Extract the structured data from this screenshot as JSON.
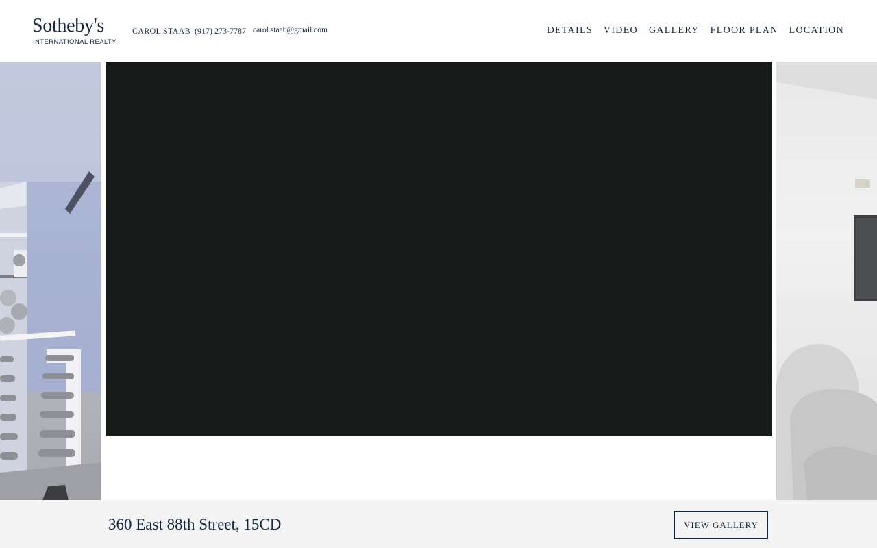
{
  "header": {
    "logo": {
      "word": "Sotheby's",
      "subtitle": "INTERNATIONAL REALTY"
    },
    "contact": {
      "name": "CAROL STAAB",
      "phone": "(917) 273-7787",
      "email": "carol.staab@gmail.com"
    },
    "nav": [
      {
        "label": "DETAILS"
      },
      {
        "label": "VIDEO"
      },
      {
        "label": "GALLERY"
      },
      {
        "label": "FLOOR PLAN"
      },
      {
        "label": "LOCATION"
      }
    ]
  },
  "listing": {
    "address": "360 East 88th Street, 15CD",
    "view_gallery_label": "VIEW GALLERY"
  },
  "colors": {
    "brand_navy": "#0f2747",
    "video_bg": "#161a18",
    "bar_bg": "#f4f4f4"
  }
}
